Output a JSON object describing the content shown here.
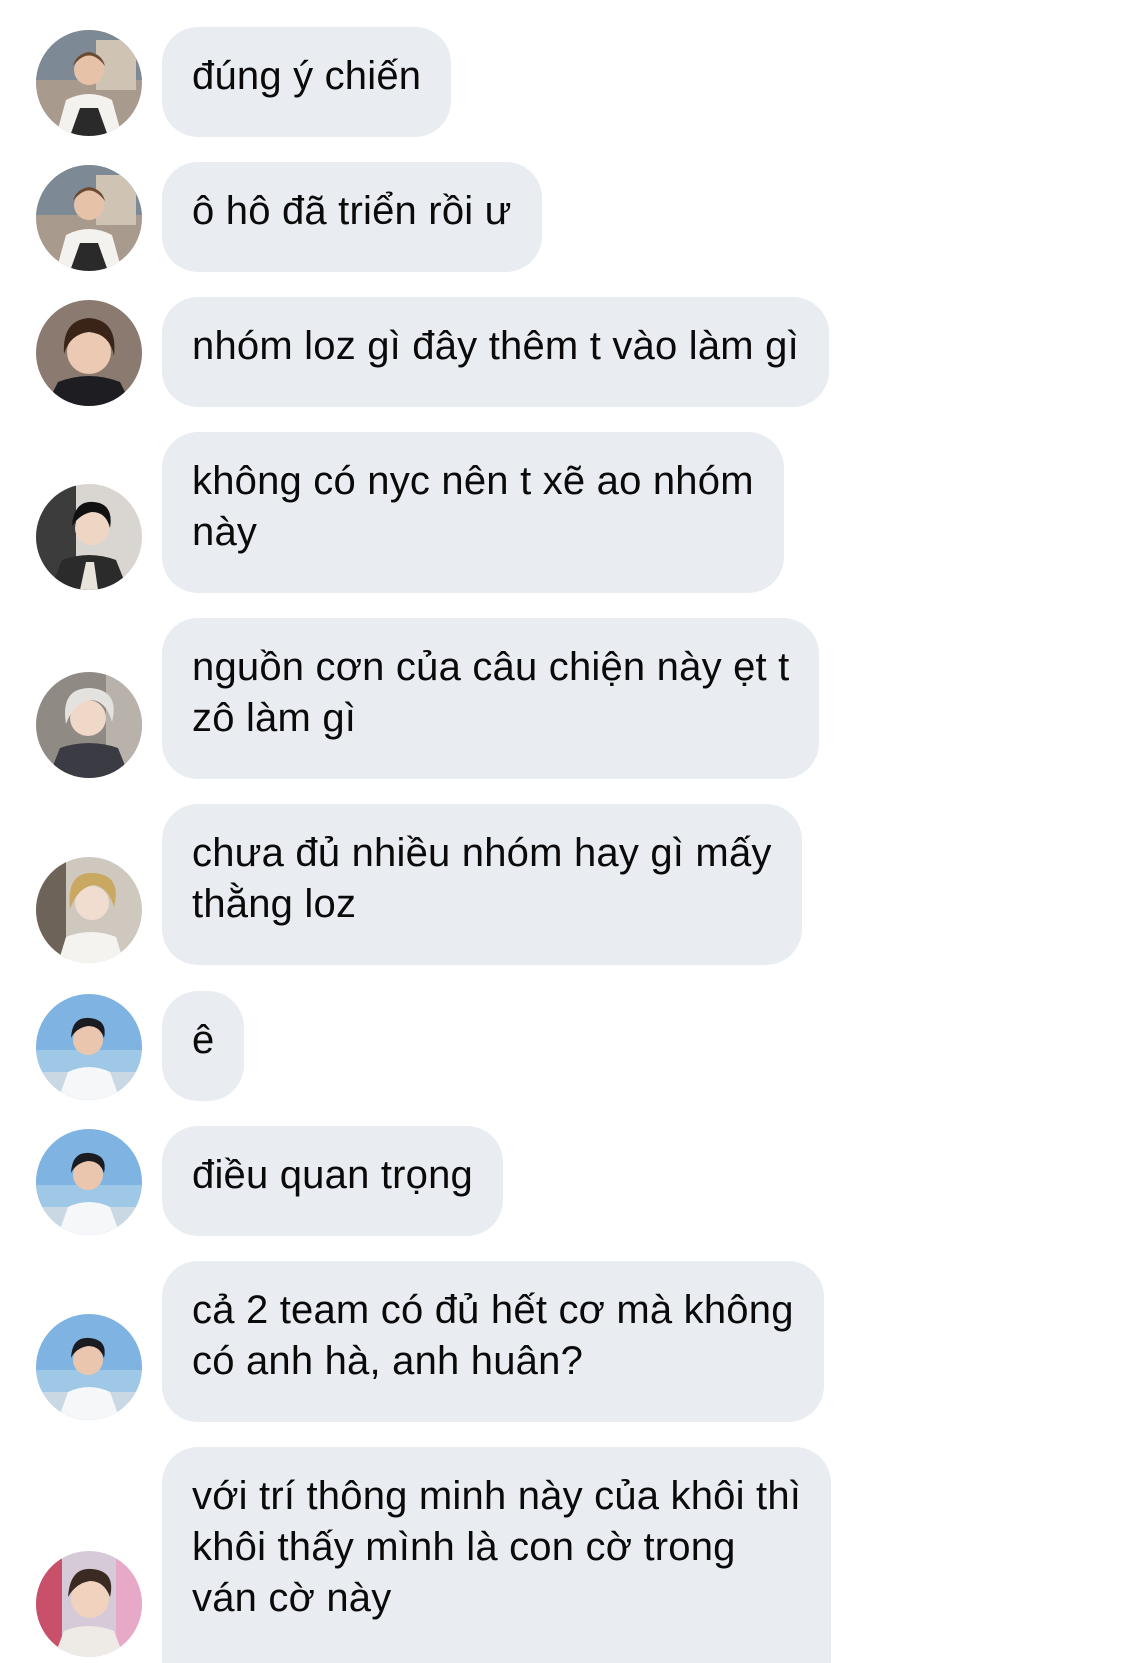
{
  "colors": {
    "bubble_bg": "#e9ecf1",
    "text": "#0a0a0a",
    "page_bg": "#ffffff"
  },
  "messages": [
    {
      "text": "đúng ý chiến",
      "avatar_icon": "avatar-person-1"
    },
    {
      "text": "ô hô đã triển rồi ư",
      "avatar_icon": "avatar-person-1"
    },
    {
      "text": "nhóm loz gì đây thêm t vào làm gì",
      "avatar_icon": "avatar-person-2"
    },
    {
      "text": "không có nyc nên t xẽ ao nhóm\nnày",
      "avatar_icon": "avatar-person-3"
    },
    {
      "text": "nguồn cơn của câu chiện này ẹt t\nzô làm gì",
      "avatar_icon": "avatar-person-4"
    },
    {
      "text": "chưa đủ nhiều nhóm hay gì mấy\nthằng loz",
      "avatar_icon": "avatar-person-5"
    },
    {
      "text": "ê",
      "avatar_icon": "avatar-person-6"
    },
    {
      "text": "điều quan trọng",
      "avatar_icon": "avatar-person-6"
    },
    {
      "text": "cả 2 team có đủ hết cơ mà không\ncó anh hà, anh huân?",
      "avatar_icon": "avatar-person-6"
    },
    {
      "text": "với trí thông minh này của khôi thì\nkhôi thấy mình là con cờ trong\nván cờ này",
      "avatar_icon": "avatar-person-7"
    }
  ]
}
